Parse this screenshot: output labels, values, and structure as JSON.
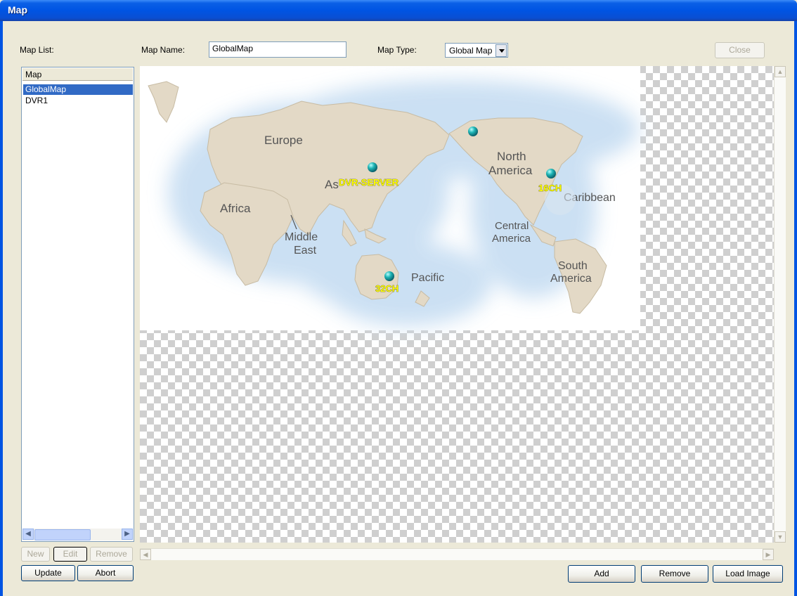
{
  "window": {
    "title": "Map"
  },
  "labels": {
    "map_list": "Map List:",
    "map_name": "Map Name:",
    "map_type": "Map Type:"
  },
  "map_name_value": "GlobalMap",
  "map_type_value": "Global Map",
  "buttons": {
    "close": "Close",
    "new": "New",
    "edit": "Edit",
    "remove_list": "Remove",
    "update": "Update",
    "abort": "Abort",
    "add": "Add",
    "remove": "Remove",
    "load_image": "Load Image"
  },
  "list": {
    "header": "Map",
    "items": [
      {
        "label": "GlobalMap",
        "selected": true
      },
      {
        "label": "DVR1",
        "selected": false
      }
    ]
  },
  "map_regions": {
    "europe": "Europe",
    "asia_prefix": "As",
    "africa": "Africa",
    "middle": "Middle",
    "east": "East",
    "north": "North",
    "america": "America",
    "caribbean": "Caribbean",
    "central": "Central",
    "central_america": "America",
    "south": "South",
    "south_america": "America",
    "pacific": "Pacific"
  },
  "markers": [
    {
      "label": "DVR-SERVER",
      "color": "#1fb6b6"
    },
    {
      "label": "16CH",
      "color": "#1fb6b6"
    },
    {
      "label": "32CH",
      "color": "#1fb6b6"
    },
    {
      "label": "",
      "color": "#1fb6b6"
    }
  ],
  "colors": {
    "land": "#e3d9c6",
    "ocean_glow": "#c6ddf2",
    "marker_label": "#ffff00",
    "selection": "#316ac5",
    "titlebar": "#0054e3"
  }
}
